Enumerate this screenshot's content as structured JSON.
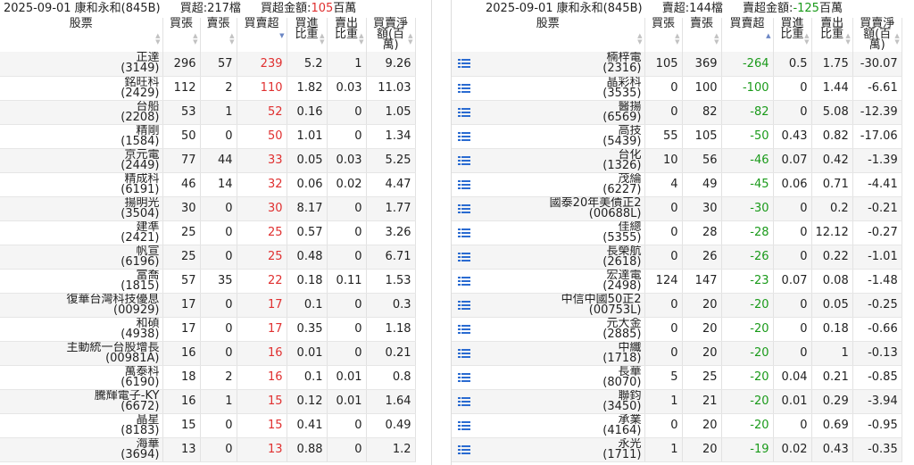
{
  "left": {
    "summary": {
      "date_broker": "2025-09-01 康和永和(845B)",
      "count_label": "買超:217檔",
      "amount_prefix": "買超金額:",
      "amount_value": "105",
      "amount_unit": "百萬"
    },
    "headers": {
      "stock": "股票",
      "buy": "買張",
      "sell": "賣張",
      "net": "買賣超",
      "buy_ratio": "買進比重",
      "sell_ratio": "賣出比重",
      "amount": "買賣淨額(百萬)"
    },
    "rows": [
      {
        "name": "正達",
        "code": "(3149)",
        "buy": "296",
        "sell": "57",
        "net": "239",
        "buy_ratio": "5.2",
        "sell_ratio": "1",
        "amount": "9.26"
      },
      {
        "name": "銘旺科",
        "code": "(2429)",
        "buy": "112",
        "sell": "2",
        "net": "110",
        "buy_ratio": "1.82",
        "sell_ratio": "0.03",
        "amount": "11.03"
      },
      {
        "name": "台船",
        "code": "(2208)",
        "buy": "53",
        "sell": "1",
        "net": "52",
        "buy_ratio": "0.16",
        "sell_ratio": "0",
        "amount": "1.05"
      },
      {
        "name": "精剛",
        "code": "(1584)",
        "buy": "50",
        "sell": "0",
        "net": "50",
        "buy_ratio": "1.01",
        "sell_ratio": "0",
        "amount": "1.34"
      },
      {
        "name": "京元電",
        "code": "(2449)",
        "buy": "77",
        "sell": "44",
        "net": "33",
        "buy_ratio": "0.05",
        "sell_ratio": "0.03",
        "amount": "5.25"
      },
      {
        "name": "精成科",
        "code": "(6191)",
        "buy": "46",
        "sell": "14",
        "net": "32",
        "buy_ratio": "0.06",
        "sell_ratio": "0.02",
        "amount": "4.47"
      },
      {
        "name": "揚明光",
        "code": "(3504)",
        "buy": "30",
        "sell": "0",
        "net": "30",
        "buy_ratio": "8.17",
        "sell_ratio": "0",
        "amount": "1.77"
      },
      {
        "name": "建準",
        "code": "(2421)",
        "buy": "25",
        "sell": "0",
        "net": "25",
        "buy_ratio": "0.57",
        "sell_ratio": "0",
        "amount": "3.26"
      },
      {
        "name": "帆宣",
        "code": "(6196)",
        "buy": "25",
        "sell": "0",
        "net": "25",
        "buy_ratio": "0.48",
        "sell_ratio": "0",
        "amount": "6.71"
      },
      {
        "name": "富喬",
        "code": "(1815)",
        "buy": "57",
        "sell": "35",
        "net": "22",
        "buy_ratio": "0.18",
        "sell_ratio": "0.11",
        "amount": "1.53"
      },
      {
        "name": "復華台灣科技優息",
        "code": "(00929)",
        "buy": "17",
        "sell": "0",
        "net": "17",
        "buy_ratio": "0.1",
        "sell_ratio": "0",
        "amount": "0.3"
      },
      {
        "name": "和碩",
        "code": "(4938)",
        "buy": "17",
        "sell": "0",
        "net": "17",
        "buy_ratio": "0.35",
        "sell_ratio": "0",
        "amount": "1.18"
      },
      {
        "name": "主動統一台股增長",
        "code": "(00981A)",
        "buy": "16",
        "sell": "0",
        "net": "16",
        "buy_ratio": "0.01",
        "sell_ratio": "0",
        "amount": "0.21"
      },
      {
        "name": "萬泰科",
        "code": "(6190)",
        "buy": "18",
        "sell": "2",
        "net": "16",
        "buy_ratio": "0.1",
        "sell_ratio": "0.01",
        "amount": "0.8"
      },
      {
        "name": "騰輝電子-KY",
        "code": "(6672)",
        "buy": "16",
        "sell": "1",
        "net": "15",
        "buy_ratio": "0.12",
        "sell_ratio": "0.01",
        "amount": "1.64"
      },
      {
        "name": "晶星",
        "code": "(8183)",
        "buy": "15",
        "sell": "0",
        "net": "15",
        "buy_ratio": "0.41",
        "sell_ratio": "0",
        "amount": "0.49"
      },
      {
        "name": "海華",
        "code": "(3694)",
        "buy": "13",
        "sell": "0",
        "net": "13",
        "buy_ratio": "0.88",
        "sell_ratio": "0",
        "amount": "1.2"
      }
    ]
  },
  "right": {
    "summary": {
      "date_broker": "2025-09-01 康和永和(845B)",
      "count_label": "賣超:144檔",
      "amount_prefix": "賣超金額:",
      "amount_value": "-125",
      "amount_unit": "百萬"
    },
    "headers": {
      "stock": "股票",
      "buy": "買張",
      "sell": "賣張",
      "net": "買賣超",
      "buy_ratio": "買進比重",
      "sell_ratio": "賣出比重",
      "amount": "買賣淨額(百萬)"
    },
    "rows": [
      {
        "name": "楠梓電",
        "code": "(2316)",
        "buy": "105",
        "sell": "369",
        "net": "-264",
        "buy_ratio": "0.5",
        "sell_ratio": "1.75",
        "amount": "-30.07"
      },
      {
        "name": "晶彩科",
        "code": "(3535)",
        "buy": "0",
        "sell": "100",
        "net": "-100",
        "buy_ratio": "0",
        "sell_ratio": "1.44",
        "amount": "-6.61"
      },
      {
        "name": "醫揚",
        "code": "(6569)",
        "buy": "0",
        "sell": "82",
        "net": "-82",
        "buy_ratio": "0",
        "sell_ratio": "5.08",
        "amount": "-12.39"
      },
      {
        "name": "高技",
        "code": "(5439)",
        "buy": "55",
        "sell": "105",
        "net": "-50",
        "buy_ratio": "0.43",
        "sell_ratio": "0.82",
        "amount": "-17.06"
      },
      {
        "name": "台化",
        "code": "(1326)",
        "buy": "10",
        "sell": "56",
        "net": "-46",
        "buy_ratio": "0.07",
        "sell_ratio": "0.42",
        "amount": "-1.39"
      },
      {
        "name": "茂綸",
        "code": "(6227)",
        "buy": "4",
        "sell": "49",
        "net": "-45",
        "buy_ratio": "0.06",
        "sell_ratio": "0.71",
        "amount": "-4.41"
      },
      {
        "name": "國泰20年美債正2",
        "code": "(00688L)",
        "buy": "0",
        "sell": "30",
        "net": "-30",
        "buy_ratio": "0",
        "sell_ratio": "0.2",
        "amount": "-0.21"
      },
      {
        "name": "佳總",
        "code": "(5355)",
        "buy": "0",
        "sell": "28",
        "net": "-28",
        "buy_ratio": "0",
        "sell_ratio": "12.12",
        "amount": "-0.27"
      },
      {
        "name": "長榮航",
        "code": "(2618)",
        "buy": "0",
        "sell": "26",
        "net": "-26",
        "buy_ratio": "0",
        "sell_ratio": "0.22",
        "amount": "-1.01"
      },
      {
        "name": "宏達電",
        "code": "(2498)",
        "buy": "124",
        "sell": "147",
        "net": "-23",
        "buy_ratio": "0.07",
        "sell_ratio": "0.08",
        "amount": "-1.48"
      },
      {
        "name": "中信中國50正2",
        "code": "(00753L)",
        "buy": "0",
        "sell": "20",
        "net": "-20",
        "buy_ratio": "0",
        "sell_ratio": "0.05",
        "amount": "-0.25"
      },
      {
        "name": "元大金",
        "code": "(2885)",
        "buy": "0",
        "sell": "20",
        "net": "-20",
        "buy_ratio": "0",
        "sell_ratio": "0.18",
        "amount": "-0.66"
      },
      {
        "name": "中纖",
        "code": "(1718)",
        "buy": "0",
        "sell": "20",
        "net": "-20",
        "buy_ratio": "0",
        "sell_ratio": "1",
        "amount": "-0.13"
      },
      {
        "name": "長華",
        "code": "(8070)",
        "buy": "5",
        "sell": "25",
        "net": "-20",
        "buy_ratio": "0.04",
        "sell_ratio": "0.21",
        "amount": "-0.85"
      },
      {
        "name": "聯鈞",
        "code": "(3450)",
        "buy": "1",
        "sell": "21",
        "net": "-20",
        "buy_ratio": "0.01",
        "sell_ratio": "0.29",
        "amount": "-3.94"
      },
      {
        "name": "承業",
        "code": "(4164)",
        "buy": "0",
        "sell": "20",
        "net": "-20",
        "buy_ratio": "0",
        "sell_ratio": "0.69",
        "amount": "-0.95"
      },
      {
        "name": "永光",
        "code": "(1711)",
        "buy": "1",
        "sell": "20",
        "net": "-19",
        "buy_ratio": "0.02",
        "sell_ratio": "0.43",
        "amount": "-0.35"
      }
    ]
  },
  "icons": {
    "row_detail": "list-icon",
    "sort": "sort-arrows-icon"
  },
  "colors": {
    "positive": "#e03030",
    "negative": "#1a9a1a",
    "row_alt": "#f5f5f5",
    "icon": "#2a6bd1"
  }
}
